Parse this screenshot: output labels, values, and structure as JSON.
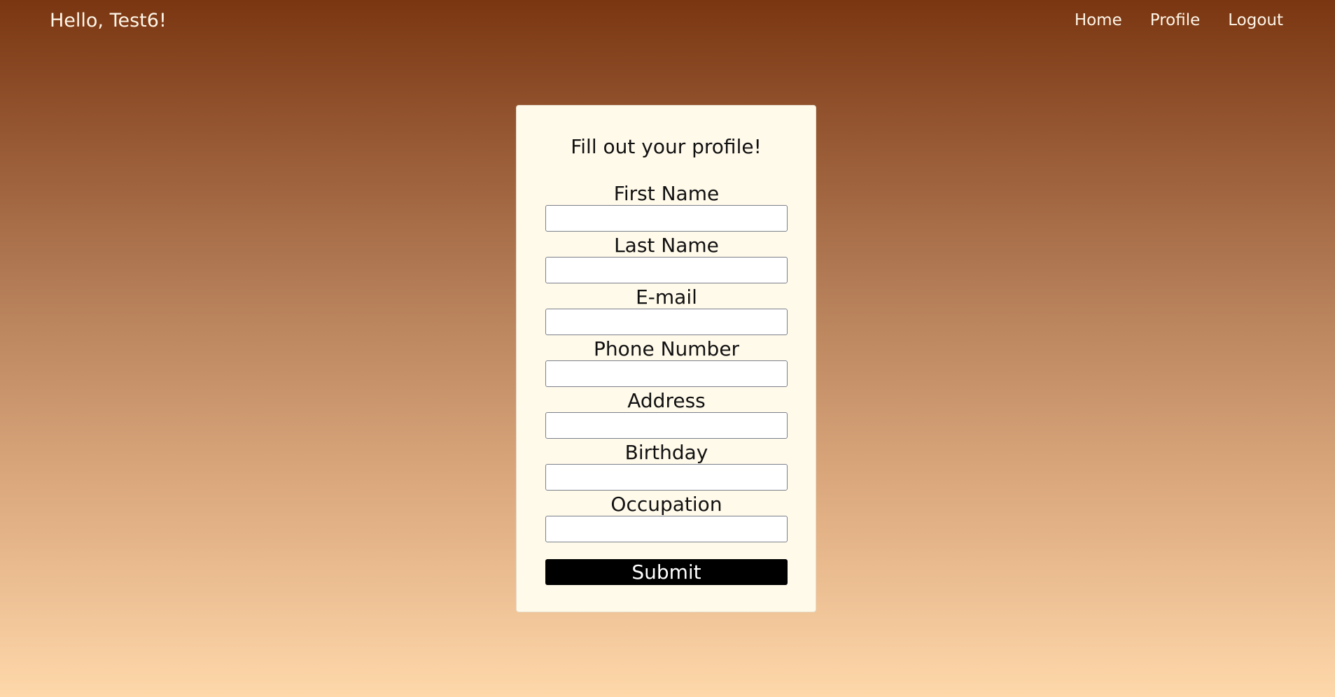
{
  "header": {
    "greeting": "Hello, Test6!",
    "nav": [
      {
        "label": "Home"
      },
      {
        "label": "Profile"
      },
      {
        "label": "Logout"
      }
    ]
  },
  "form": {
    "title": "Fill out your profile!",
    "fields": [
      {
        "label": "First Name",
        "value": "",
        "placeholder": ""
      },
      {
        "label": "Last Name",
        "value": "",
        "placeholder": ""
      },
      {
        "label": "E-mail",
        "value": "",
        "placeholder": ""
      },
      {
        "label": "Phone Number",
        "value": "",
        "placeholder": ""
      },
      {
        "label": "Address",
        "value": "",
        "placeholder": ""
      },
      {
        "label": "Birthday",
        "value": "",
        "placeholder": ""
      },
      {
        "label": "Occupation",
        "value": "",
        "placeholder": ""
      }
    ],
    "submit_label": "Submit"
  },
  "colors": {
    "gradient_top": "#7a3611",
    "gradient_bottom": "#fed8aa",
    "card_background": "#fffaea",
    "button_background": "#000000"
  }
}
